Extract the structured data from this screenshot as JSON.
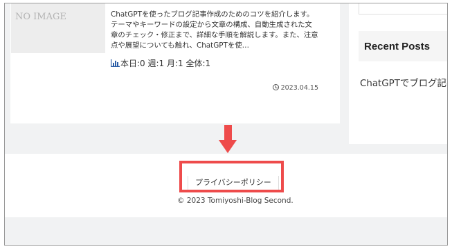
{
  "post": {
    "thumbnail_text": "NO IMAGE",
    "excerpt": "ChatGPTを使ったブログ記事作成のためのコツを紹介します。テーマやキーワードの設定から文章の構成、自動生成された文章のチェック・修正まで、詳細な手順を解説します。また、注意点や展望についても触れ、ChatGPTを使…",
    "stats": "本日:0 週:1 月:1 全体:1",
    "date": "2023.04.15"
  },
  "sidebar": {
    "recent_posts_title": "Recent Posts",
    "recent_post_link": "ChatGPTでブログ記事 コツ【網羅的にまと"
  },
  "footer": {
    "privacy_link": "プライバシーポリシー",
    "copyright": "© 2023 Tomiyoshi-Blog Second."
  },
  "colors": {
    "annotation": "#ee4b4b",
    "page_background": "#f1f2f3"
  },
  "icons": [
    "bar-chart-icon",
    "clock-icon",
    "arrow-down-icon"
  ]
}
